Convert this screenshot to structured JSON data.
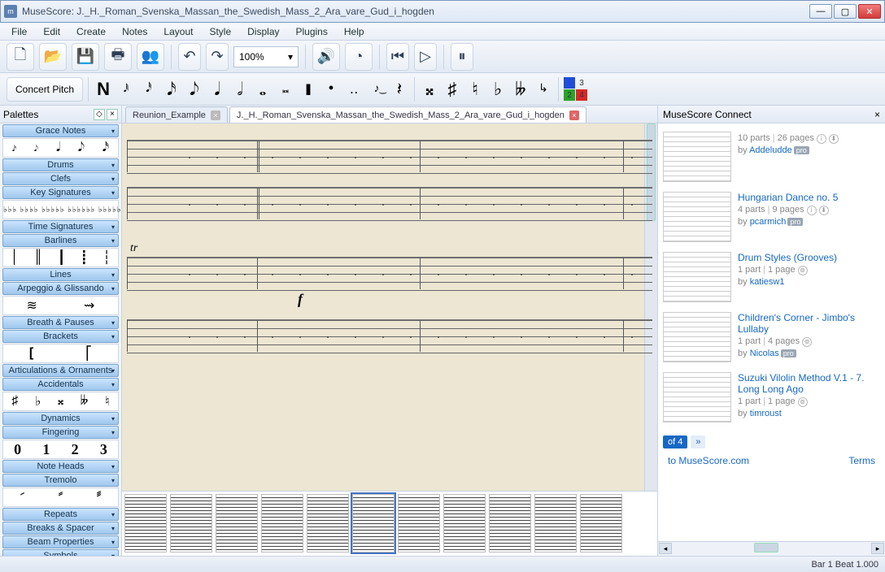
{
  "title": "MuseScore: J._H._Roman_Svenska_Massan_the_Swedish_Mass_2_Ara_vare_Gud_i_hogden",
  "menu": [
    "File",
    "Edit",
    "Create",
    "Notes",
    "Layout",
    "Style",
    "Display",
    "Plugins",
    "Help"
  ],
  "toolbar": {
    "zoom": "100%"
  },
  "notebar": {
    "concert_pitch": "Concert Pitch",
    "voices": [
      "1",
      "2",
      "3",
      "4"
    ]
  },
  "palettes": {
    "header": "Palettes",
    "cats": [
      "Grace Notes",
      "Drums",
      "Clefs",
      "Key Signatures",
      "Time Signatures",
      "Barlines",
      "Lines",
      "Arpeggio & Glissando",
      "Breath & Pauses",
      "Brackets",
      "Articulations & Ornaments",
      "Accidentals",
      "Dynamics",
      "Fingering",
      "Note Heads",
      "Tremolo",
      "Repeats",
      "Breaks & Spacer",
      "Beam Properties",
      "Symbols"
    ],
    "fingering": [
      "0",
      "1",
      "2",
      "3"
    ]
  },
  "tabs": [
    {
      "label": "Reunion_Example",
      "active": false
    },
    {
      "label": "J._H._Roman_Svenska_Massan_the_Swedish_Mass_2_Ara_vare_Gud_i_hogden",
      "active": true
    }
  ],
  "connect": {
    "header": "MuseScore Connect",
    "items": [
      {
        "title": "",
        "parts": "10 parts",
        "pages": "26 pages",
        "by": "Addeludde",
        "pro": true
      },
      {
        "title": "Hungarian Dance no. 5",
        "parts": "4 parts",
        "pages": "9 pages",
        "by": "pcarmich",
        "pro": true
      },
      {
        "title": "Drum Styles (Grooves)",
        "parts": "1 part",
        "pages": "1 page",
        "by": "katiesw1",
        "pro": false
      },
      {
        "title": "Children's Corner - Jimbo's Lullaby",
        "parts": "1 part",
        "pages": "4 pages",
        "by": "Nicolas",
        "pro": true
      },
      {
        "title": "Suzuki Vilolin Method V.1 - 7. Long Long Ago",
        "parts": "1 part",
        "pages": "1 page",
        "by": "timroust",
        "pro": false
      }
    ],
    "pager": "of 4",
    "footer_left": "to MuseScore.com",
    "footer_right": "Terms"
  },
  "status": "Bar  1 Beat  1.000"
}
